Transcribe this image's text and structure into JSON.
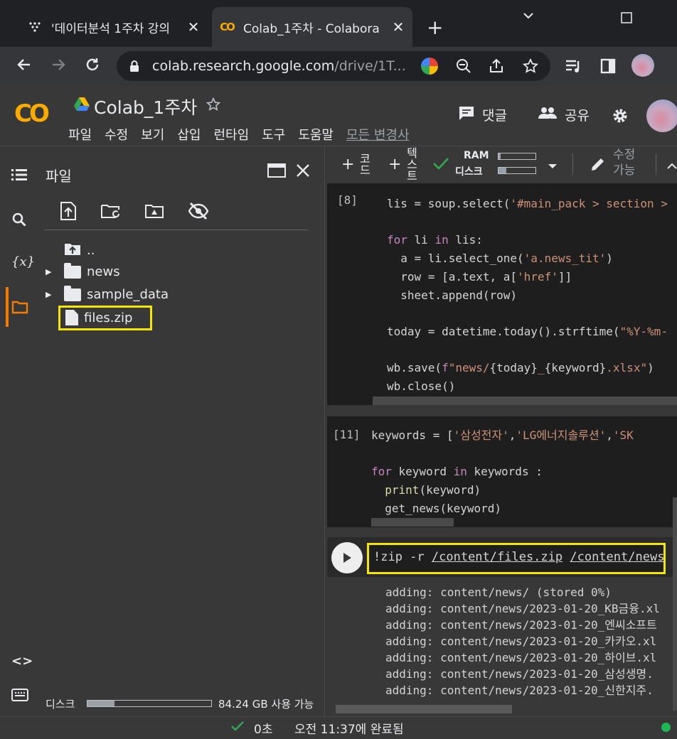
{
  "browser": {
    "tabs": [
      {
        "title": "'데이터분석 1주차 강의",
        "close": "✕"
      },
      {
        "title": "Colab_1주차 - Colabora",
        "close": "✕"
      }
    ],
    "new_tab": "+",
    "url_host": "colab.research.google.com",
    "url_path": "/drive/1T..."
  },
  "colab": {
    "logo": "CO",
    "notebook_title": "Colab_1주차",
    "menu": [
      "파일",
      "수정",
      "보기",
      "삽입",
      "런타임",
      "도구",
      "도움말",
      "모든 변경사"
    ],
    "comment_label": "댓글",
    "share_label": "공유"
  },
  "sidebar": {
    "panel_title": "파일",
    "tree": [
      {
        "name": ".."
      },
      {
        "name": "news"
      },
      {
        "name": "sample_data"
      },
      {
        "name": "files.zip"
      }
    ],
    "disk_label": "디스크",
    "disk_available": "84.24 GB 사용 가능",
    "disk_usage_fraction": 0.22
  },
  "toolbar": {
    "code_label": "코드",
    "text_label": "텍스트",
    "ram_label": "RAM",
    "disk_label": "디스크",
    "edit_label": "수정 가능",
    "ram_usage_fraction": 0.05,
    "disk_usage_fraction": 0.22
  },
  "cells": {
    "cell8_number": "[8]",
    "cell11_number": "[11]",
    "zip_command_prefix": "!zip -r ",
    "zip_path1": "/content/files.zip",
    "zip_path2": "/content/news"
  },
  "output_lines": [
    "adding: content/news/ (stored 0%)",
    "adding: content/news/2023-01-20_KB금융.xl",
    "adding: content/news/2023-01-20_엔씨소프트",
    "adding: content/news/2023-01-20_카카오.xl",
    "adding: content/news/2023-01-20_하이브.xl",
    "adding: content/news/2023-01-20_삼성생명.",
    "adding: content/news/2023-01-20_신한지주."
  ],
  "status": {
    "elapsed": "0초",
    "completed_text": "오전 11:37에 완료됨"
  },
  "colors": {
    "highlight": "#f5e600",
    "status_ok": "#34a853",
    "colab_orange": "#f9ab00"
  }
}
